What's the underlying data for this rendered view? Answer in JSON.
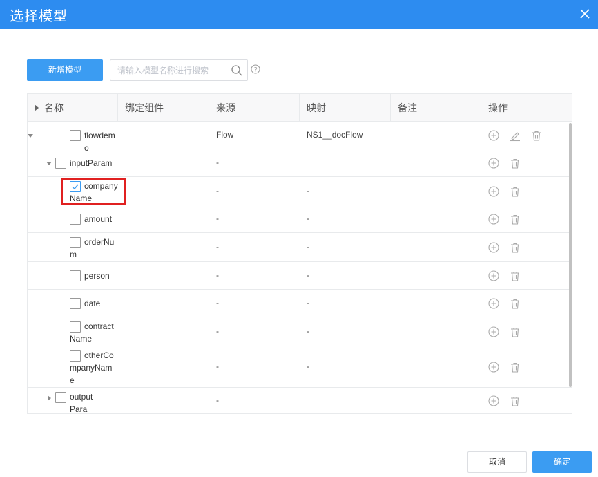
{
  "dialog": {
    "title": "选择模型",
    "close_icon": "close-icon"
  },
  "toolbar": {
    "add_label": "新增模型",
    "search_placeholder": "请输入模型名称进行搜索",
    "search_icon": "search-icon",
    "help_icon": "help-icon"
  },
  "table": {
    "columns": [
      "名称",
      "绑定组件",
      "来源",
      "映射",
      "备注",
      "操作"
    ],
    "rows": [
      {
        "name_lines": [
          "flowdemo"
        ],
        "source": "Flow",
        "mapping": "NS1__docFlow",
        "note": "",
        "expand": "down",
        "checked": false,
        "actions": [
          "add-icon",
          "edit-icon",
          "delete-icon"
        ]
      },
      {
        "name_lines": [
          "inputParam"
        ],
        "source": "-",
        "mapping": "",
        "note": "",
        "expand": "down",
        "checked": false,
        "actions": [
          "add-icon",
          "delete-icon"
        ]
      },
      {
        "name_lines": [
          "company",
          "Name"
        ],
        "source": "-",
        "mapping": "-",
        "note": "",
        "expand": "",
        "checked": true,
        "actions": [
          "add-icon",
          "delete-icon"
        ]
      },
      {
        "name_lines": [
          "amount"
        ],
        "source": "-",
        "mapping": "-",
        "note": "",
        "expand": "",
        "checked": false,
        "actions": [
          "add-icon",
          "delete-icon"
        ]
      },
      {
        "name_lines": [
          "orderNu",
          "m"
        ],
        "source": "-",
        "mapping": "-",
        "note": "",
        "expand": "",
        "checked": false,
        "actions": [
          "add-icon",
          "delete-icon"
        ]
      },
      {
        "name_lines": [
          "person"
        ],
        "source": "-",
        "mapping": "-",
        "note": "",
        "expand": "",
        "checked": false,
        "actions": [
          "add-icon",
          "delete-icon"
        ]
      },
      {
        "name_lines": [
          "date"
        ],
        "source": "-",
        "mapping": "-",
        "note": "",
        "expand": "",
        "checked": false,
        "actions": [
          "add-icon",
          "delete-icon"
        ]
      },
      {
        "name_lines": [
          "contract",
          "Name"
        ],
        "source": "-",
        "mapping": "-",
        "note": "",
        "expand": "",
        "checked": false,
        "actions": [
          "add-icon",
          "delete-icon"
        ]
      },
      {
        "name_lines": [
          "otherCo",
          "mpanyNam",
          "e"
        ],
        "source": "-",
        "mapping": "-",
        "note": "",
        "expand": "",
        "checked": false,
        "actions": [
          "add-icon",
          "delete-icon"
        ]
      },
      {
        "name_lines": [
          "outputPara",
          "m"
        ],
        "source": "-",
        "mapping": "",
        "note": "",
        "expand": "right",
        "checked": false,
        "actions": [
          "add-icon",
          "delete-icon"
        ]
      }
    ]
  },
  "footer": {
    "cancel_label": "取消",
    "ok_label": "确定"
  },
  "colors": {
    "primary": "#2d8cf0",
    "button": "#3b9cf2",
    "highlight": "#e02020"
  }
}
